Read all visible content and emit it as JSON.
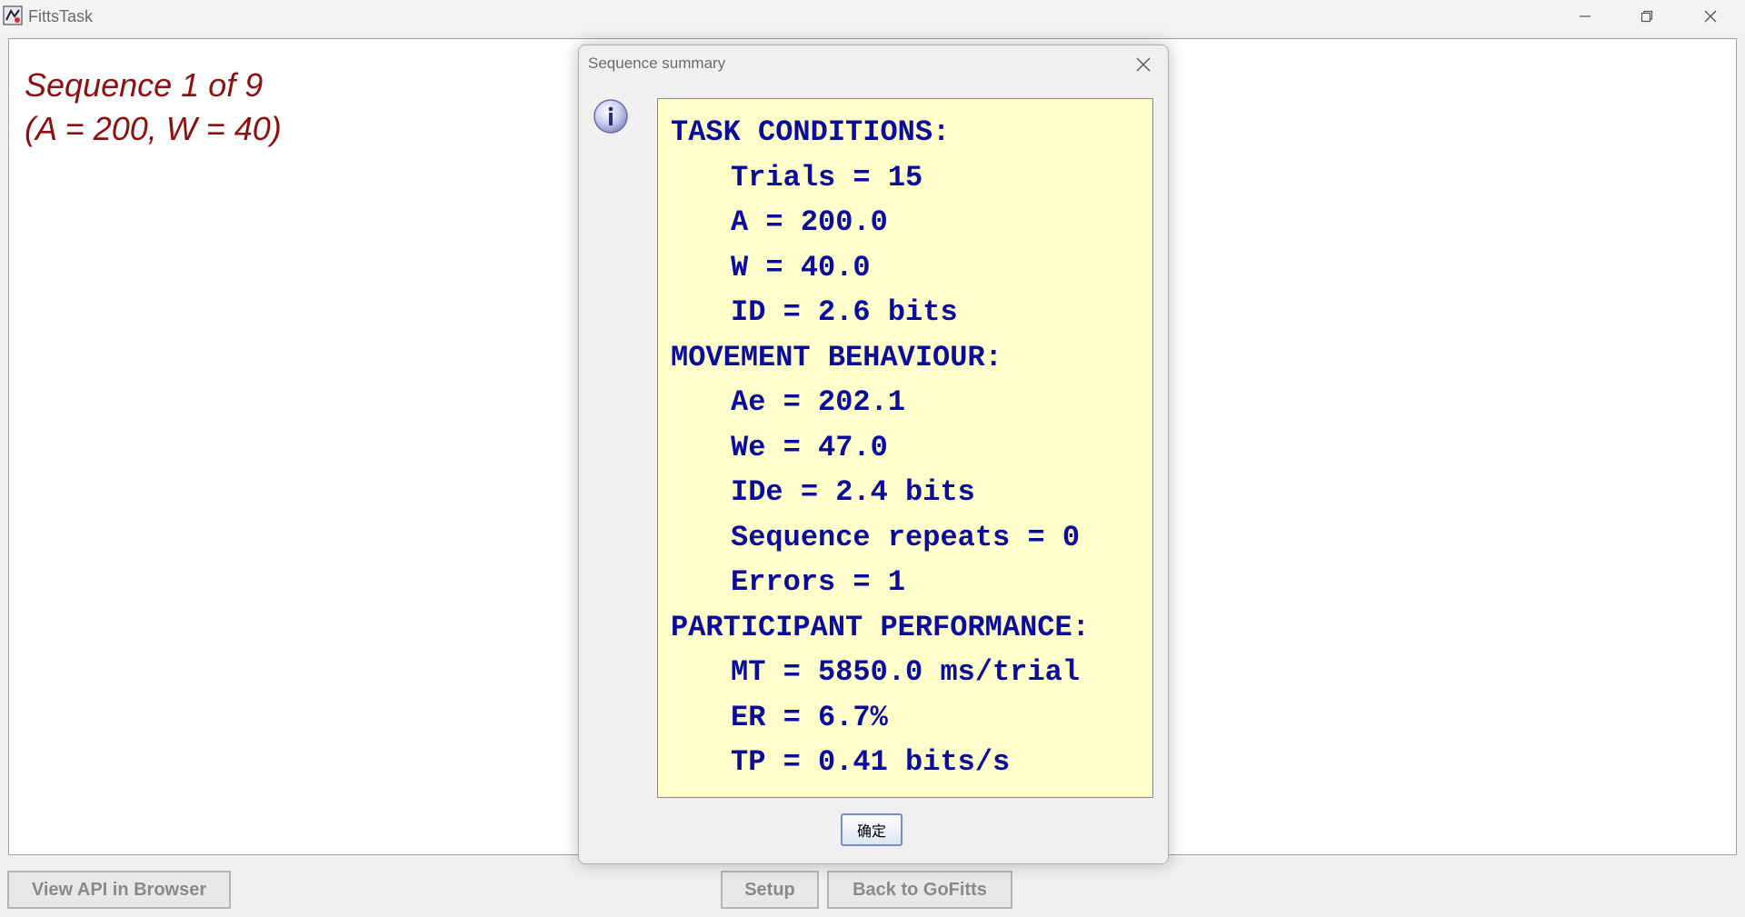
{
  "window": {
    "title": "FittsTask",
    "icon": "java-app-icon",
    "controls": [
      "minimize-icon",
      "maximize-icon",
      "close-icon"
    ]
  },
  "canvas": {
    "sequence_line": "Sequence 1 of 9",
    "params_line": "(A = 200, W = 40)"
  },
  "bottom_buttons": {
    "api": "View API in Browser",
    "setup": "Setup",
    "back": "Back to GoFitts"
  },
  "dialog": {
    "title": "Sequence summary",
    "icon": "info-icon",
    "lines": [
      "TASK CONDITIONS:",
      "Trials = 15",
      "A = 200.0",
      "W = 40.0",
      "ID = 2.6 bits",
      "MOVEMENT BEHAVIOUR:",
      "Ae = 202.1",
      "We = 47.0",
      "IDe = 2.4 bits",
      "Sequence repeats = 0",
      "Errors = 1",
      "PARTICIPANT PERFORMANCE:",
      "MT = 5850.0 ms/trial",
      "ER = 6.7%",
      "TP = 0.41 bits/s"
    ],
    "ok_label": "确定"
  },
  "colors": {
    "sequence_text": "#8b1010",
    "summary_text": "#0b0b9c",
    "summary_bg": "#ffffcc"
  }
}
